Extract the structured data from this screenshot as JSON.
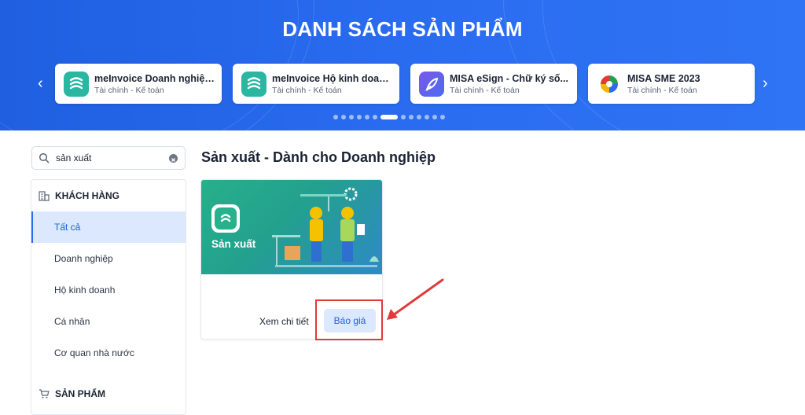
{
  "hero": {
    "title": "DANH SÁCH SẢN PHẨM",
    "prev_label": "‹",
    "next_label": "›",
    "cards": [
      {
        "name": "meInvoice Doanh nghiệp ...",
        "category": "Tài chính - Kế toán"
      },
      {
        "name": "meInvoice Hộ kinh doanh...",
        "category": "Tài chính - Kế toán"
      },
      {
        "name": "MISA eSign - Chữ ký số...",
        "category": "Tài chính - Kế toán"
      },
      {
        "name": "MISA SME 2023",
        "category": "Tài chính - Kế toán"
      }
    ],
    "dots_total": 13,
    "dots_active_index": 6
  },
  "search": {
    "value": "sản xuất",
    "placeholder": ""
  },
  "sidebar": {
    "customer_header": "KHÁCH HÀNG",
    "items": [
      {
        "label": "Tất cả",
        "active": true
      },
      {
        "label": "Doanh nghiệp",
        "active": false
      },
      {
        "label": "Hộ kinh doanh",
        "active": false
      },
      {
        "label": "Cá nhân",
        "active": false
      },
      {
        "label": "Cơ quan nhà nước",
        "active": false
      }
    ],
    "product_header": "SẢN PHẨM"
  },
  "main": {
    "title": "Sản xuất - Dành cho Doanh nghiệp",
    "product": {
      "banner_name": "Sản xuất",
      "detail_label": "Xem chi tiết",
      "quote_label": "Báo giá"
    }
  },
  "colors": {
    "brand_blue": "#2a6cf0",
    "highlight_red": "#e03a3a",
    "banner_green": "#27b08a"
  }
}
